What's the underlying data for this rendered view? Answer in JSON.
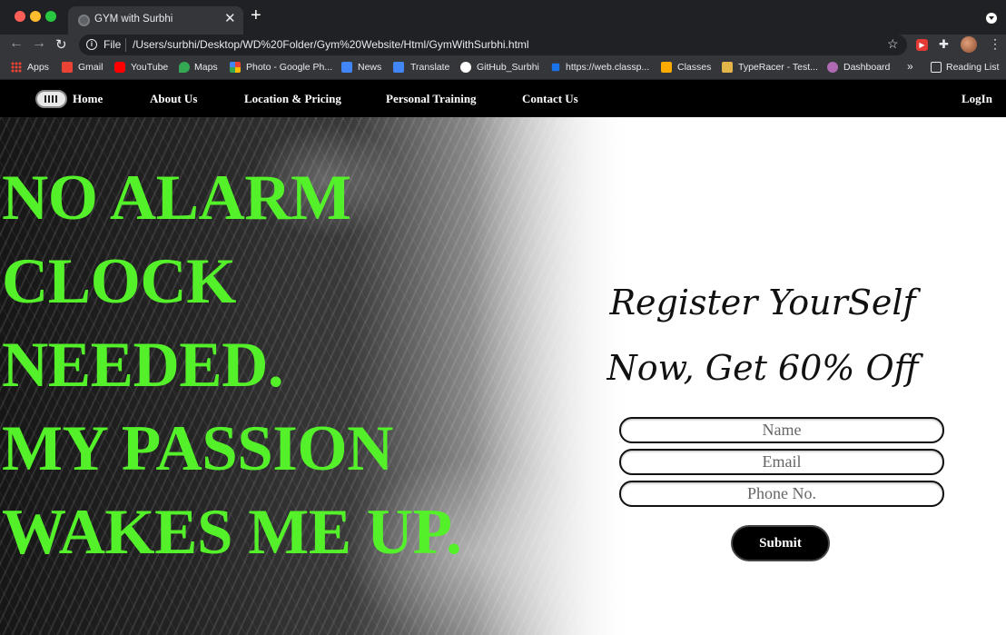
{
  "browser": {
    "tab_title": "GYM with Surbhi",
    "tab_close": "✕",
    "new_tab": "+",
    "file_label": "File",
    "url": "/Users/surbhi/Desktop/WD%20Folder/Gym%20Website/Html/GymWithSurbhi.html",
    "bookmarks": [
      {
        "label": "Apps",
        "icon": "apps-grid-icon"
      },
      {
        "label": "Gmail",
        "icon": "gmail-icon",
        "color": "#ea4335"
      },
      {
        "label": "YouTube",
        "icon": "youtube-icon",
        "color": "#ff0000"
      },
      {
        "label": "Maps",
        "icon": "maps-icon",
        "color": "#34a853"
      },
      {
        "label": "Photo - Google Ph...",
        "icon": "google-photos-icon",
        "color": "#fbbc04"
      },
      {
        "label": "News",
        "icon": "news-icon",
        "color": "#4285f4"
      },
      {
        "label": "Translate",
        "icon": "translate-icon",
        "color": "#4285f4"
      },
      {
        "label": "GitHub_Surbhi",
        "icon": "github-icon",
        "color": "#ffffff"
      },
      {
        "label": "https://web.classp...",
        "icon": "classpro-icon",
        "color": "#1a73e8"
      },
      {
        "label": "Classes",
        "icon": "classroom-icon",
        "color": "#f9ab00"
      },
      {
        "label": "TypeRacer - Test...",
        "icon": "typeracer-icon",
        "color": "#e2b44a"
      },
      {
        "label": "Dashboard",
        "icon": "dashboard-icon",
        "color": "#b06ab3"
      }
    ],
    "overflow": "»",
    "reading_list": "Reading List"
  },
  "site": {
    "nav": {
      "links": [
        "Home",
        "About Us",
        "Location & Pricing",
        "Personal Training",
        "Contact Us"
      ],
      "login": "LogIn"
    },
    "headline": [
      "NO ALARM",
      "CLOCK",
      "NEEDED.",
      "MY PASSION",
      "WAKES ME UP."
    ],
    "accent_color": "#54f12a",
    "register": {
      "line1": "Register YourSelf",
      "line2": "Now, Get 60% Off",
      "name_placeholder": "Name",
      "email_placeholder": "Email",
      "phone_placeholder": "Phone No.",
      "submit_label": "Submit"
    }
  }
}
